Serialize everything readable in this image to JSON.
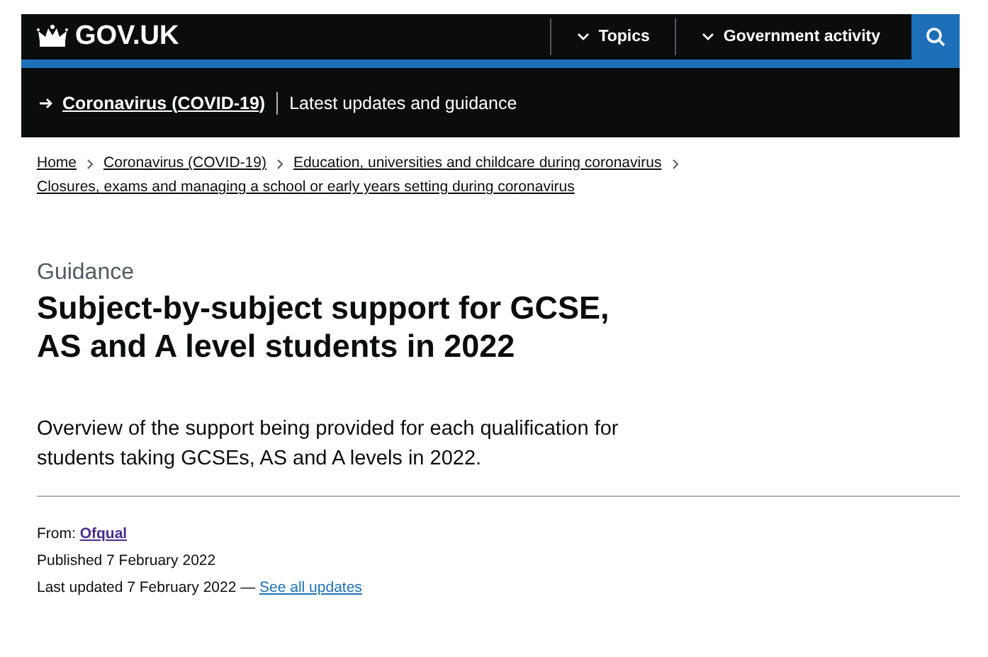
{
  "header": {
    "logo": "GOV.UK",
    "nav": [
      {
        "label": "Topics"
      },
      {
        "label": "Government activity"
      }
    ]
  },
  "banner": {
    "link": "Coronavirus (COVID-19)",
    "text": "Latest updates and guidance"
  },
  "breadcrumbs": [
    {
      "label": "Home"
    },
    {
      "label": "Coronavirus (COVID-19)"
    },
    {
      "label": "Education, universities and childcare during coronavirus"
    },
    {
      "label": "Closures, exams and managing a school or early years setting during coronavirus"
    }
  ],
  "caption": "Guidance",
  "title": "Subject-by-subject support for GCSE, AS and A level students in 2022",
  "summary": "Overview of the support being provided for each qualification for students taking GCSEs, AS and A levels in 2022.",
  "metadata": {
    "from_label": "From:",
    "from_link": "Ofqual",
    "published": "Published 7 February 2022",
    "updated": "Last updated 7 February 2022 —",
    "updates_link": "See all updates"
  }
}
